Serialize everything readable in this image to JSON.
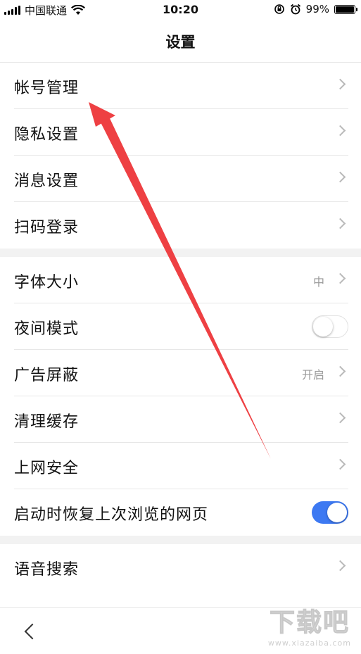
{
  "status_bar": {
    "carrier": "中国联通",
    "time": "10:20",
    "battery": "99%",
    "battery_level": 0.99
  },
  "header": {
    "title": "设置"
  },
  "groups": [
    [
      {
        "label": "帐号管理",
        "control": "chevron"
      },
      {
        "label": "隐私设置",
        "control": "chevron"
      },
      {
        "label": "消息设置",
        "control": "chevron"
      },
      {
        "label": "扫码登录",
        "control": "chevron"
      }
    ],
    [
      {
        "label": "字体大小",
        "value": "中",
        "control": "chevron"
      },
      {
        "label": "夜间模式",
        "control": "toggle",
        "on": false
      },
      {
        "label": "广告屏蔽",
        "value": "开启",
        "control": "chevron"
      },
      {
        "label": "清理缓存",
        "control": "chevron"
      },
      {
        "label": "上网安全",
        "control": "chevron"
      },
      {
        "label": "启动时恢复上次浏览的网页",
        "control": "toggle",
        "on": true
      }
    ],
    [
      {
        "label": "语音搜索",
        "control": "chevron"
      }
    ]
  ],
  "bottom_bar": {
    "back_icon": "back-chevron-icon"
  },
  "watermark": {
    "text": "下载吧",
    "url": "www.xiazaiba.com"
  },
  "colors": {
    "accent": "#3d79f2",
    "annotation_arrow": "#ee4043"
  }
}
